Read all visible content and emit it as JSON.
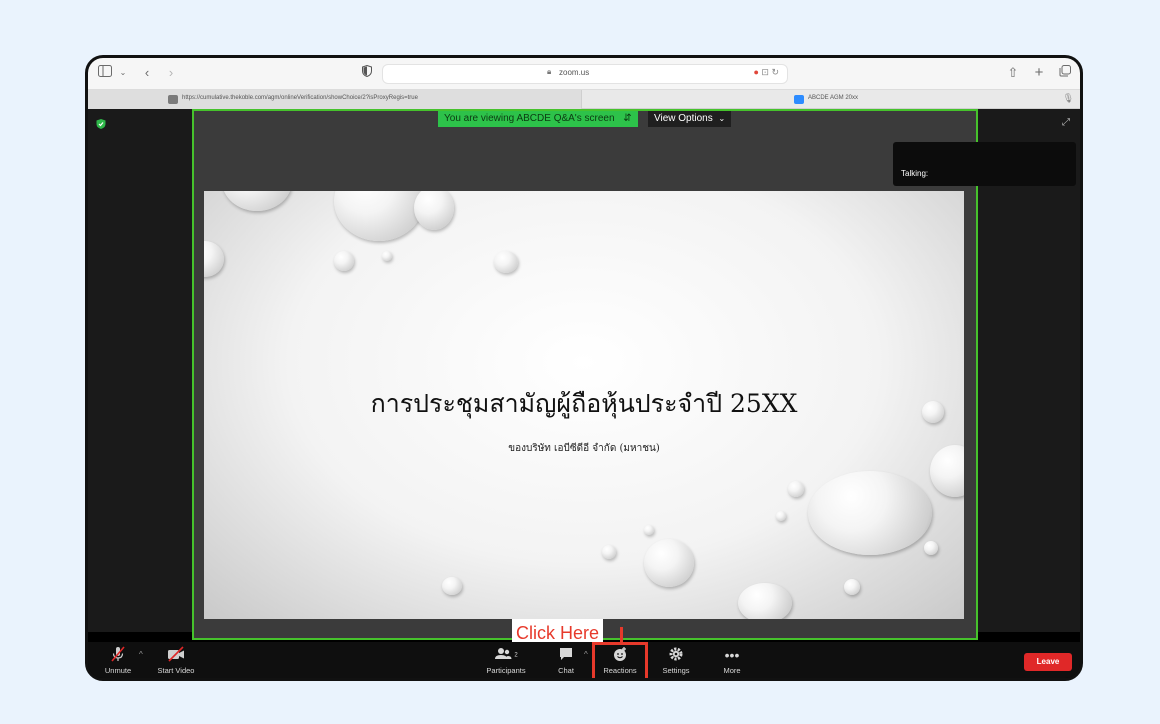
{
  "browser": {
    "address": "zoom.us",
    "tabs": [
      {
        "title": "https://cumulative.thekoble.com/agm/onlineVerification/showChoice/2?isProxyRegis=true"
      },
      {
        "title": "ABCDE AGM 20xx"
      }
    ]
  },
  "zoom": {
    "share_banner": "You are viewing ABCDE Q&A's screen",
    "view_options": "View Options",
    "talking_label": "Talking:",
    "slide": {
      "title": "การประชุมสามัญผู้ถือหุ้นประจำปี 25XX",
      "subtitle": "ของบริษัท เอบีซีดีอี จำกัด (มหาชน)"
    },
    "callout": "Click Here",
    "controls": {
      "unmute": "Unmute",
      "start_video": "Start Video",
      "participants": "Participants",
      "participants_count": "2",
      "chat": "Chat",
      "reactions": "Reactions",
      "settings": "Settings",
      "more": "More",
      "leave": "Leave"
    }
  },
  "colors": {
    "page_bg": "#eaf3fd",
    "share_border": "#46c22c",
    "banner_green": "#2dc24a",
    "leave_red": "#e02828",
    "highlight_red": "#e7392b"
  }
}
